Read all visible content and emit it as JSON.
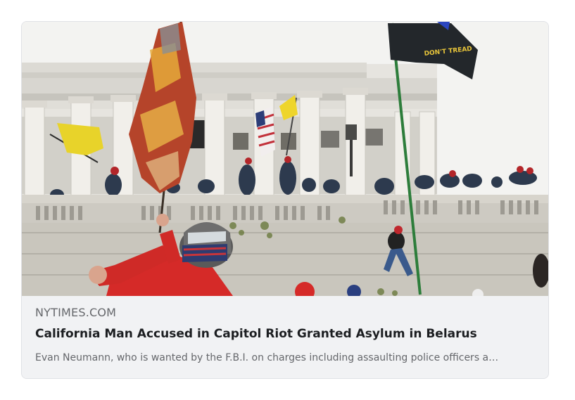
{
  "link_preview": {
    "source_domain": "NYTIMES.COM",
    "headline": "California Man Accused in Capitol Riot Granted Asylum in Belarus",
    "description": "Evan Neumann, who is wanted by the F.B.I. on charges including assaulting police officers a…",
    "image": {
      "subject": "capitol-riot-photo",
      "flag_text": "DON'T TREAD"
    }
  }
}
